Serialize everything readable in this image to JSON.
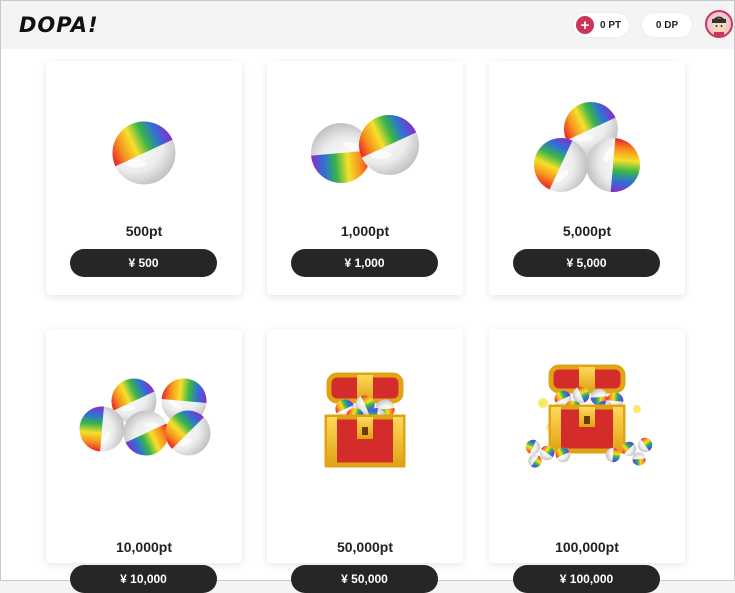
{
  "header": {
    "logo_text": "DOPA!",
    "points_value": "0",
    "points_unit": "PT",
    "dp_value": "0",
    "dp_unit": "DP"
  },
  "products": [
    {
      "label": "500pt",
      "price": "¥ 500",
      "icon": "single-capsule-icon"
    },
    {
      "label": "1,000pt",
      "price": "¥ 1,000",
      "icon": "two-capsules-icon"
    },
    {
      "label": "5,000pt",
      "price": "¥ 5,000",
      "icon": "three-capsules-icon"
    },
    {
      "label": "10,000pt",
      "price": "¥ 10,000",
      "icon": "capsule-pile-icon"
    },
    {
      "label": "50,000pt",
      "price": "¥ 50,000",
      "icon": "treasure-chest-icon"
    },
    {
      "label": "100,000pt",
      "price": "¥ 100,000",
      "icon": "treasure-chest-large-icon"
    }
  ]
}
